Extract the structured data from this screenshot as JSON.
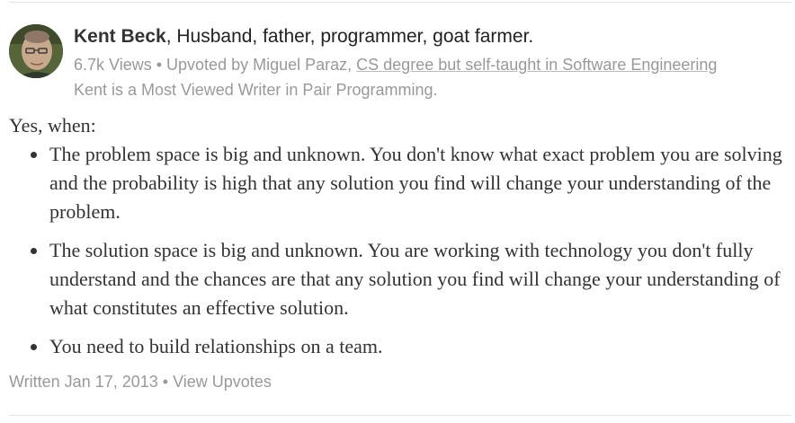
{
  "answer": {
    "author": {
      "name": "Kent Beck",
      "bio": ", Husband, father, programmer, goat farmer.",
      "avatar_icon": "author-avatar"
    },
    "meta": {
      "views": "6.7k Views",
      "separator": " • ",
      "upvoted_by_prefix": "Upvoted by ",
      "upvoter_name": "Miguel Paraz",
      "upvoter_separator": ", ",
      "upvoter_credential": "CS degree but self-taught in Software Engineering"
    },
    "credential": "Kent is a Most Viewed Writer in Pair Programming.",
    "body": {
      "intro": "Yes, when:",
      "items": [
        "The problem space is big and unknown. You don't know what exact problem you are solving and the probability is high that any solution you find will change your understanding of the problem.",
        "The solution space is big and unknown. You are working with technology you don't fully understand and the chances are that any solution you find will change your understanding of what constitutes an effective solution.",
        "You need to build relationships on a team."
      ]
    },
    "footer": {
      "written": "Written Jan 17, 2013",
      "separator": " • ",
      "view_upvotes": "View Upvotes"
    }
  },
  "colors": {
    "text": "#333333",
    "muted": "#999999",
    "divider": "#e6e6e6"
  }
}
